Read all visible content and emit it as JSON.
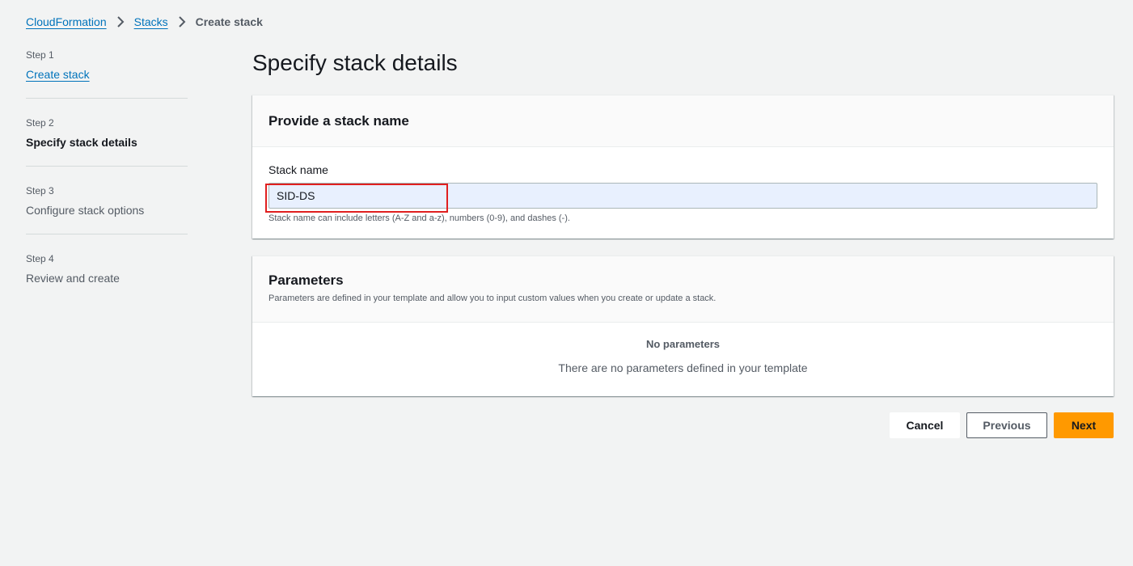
{
  "breadcrumb": {
    "items": [
      "CloudFormation",
      "Stacks"
    ],
    "current": "Create stack"
  },
  "steps": [
    {
      "num": "Step 1",
      "label": "Create stack"
    },
    {
      "num": "Step 2",
      "label": "Specify stack details"
    },
    {
      "num": "Step 3",
      "label": "Configure stack options"
    },
    {
      "num": "Step 4",
      "label": "Review and create"
    }
  ],
  "page": {
    "title": "Specify stack details"
  },
  "stack_name_section": {
    "header": "Provide a stack name",
    "field_label": "Stack name",
    "value": "SID-DS",
    "hint": "Stack name can include letters (A-Z and a-z), numbers (0-9), and dashes (-)."
  },
  "parameters_section": {
    "header": "Parameters",
    "description": "Parameters are defined in your template and allow you to input custom values when you create or update a stack.",
    "empty_title": "No parameters",
    "empty_description": "There are no parameters defined in your template"
  },
  "actions": {
    "cancel": "Cancel",
    "previous": "Previous",
    "next": "Next"
  },
  "colors": {
    "link": "#0073bb",
    "primary_button": "#ff9900",
    "highlight": "#e01f1f",
    "autofill_bg": "#e8f0fe"
  },
  "icons": [
    "chevron-right-icon"
  ]
}
